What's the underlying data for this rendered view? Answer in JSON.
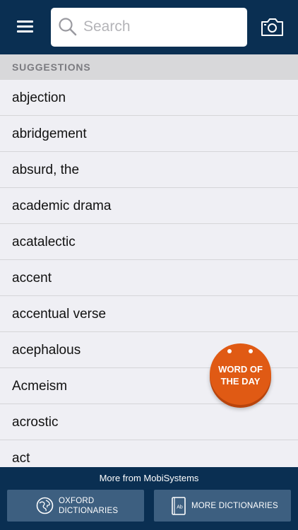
{
  "search": {
    "placeholder": "Search"
  },
  "section_header": "SUGGESTIONS",
  "suggestions": [
    "abjection",
    "abridgement",
    "absurd, the",
    "academic drama",
    "acatalectic",
    "accent",
    "accentual verse",
    "acephalous",
    "Acmeism",
    "acrostic",
    "act"
  ],
  "word_of_the_day": {
    "line1": "WORD OF",
    "line2": "THE DAY"
  },
  "footer": {
    "title": "More from MobiSystems",
    "oxford_line1": "OXFORD",
    "oxford_line2": "DICTIONARIES",
    "more_label": "MORE DICTIONARIES",
    "book_icon_text": "Ab"
  },
  "colors": {
    "header_bg": "#0a2f52",
    "accent_orange": "#e05a14",
    "button_bg": "#3d5f80"
  },
  "icons": [
    "hamburger-menu-icon",
    "search-icon",
    "camera-icon",
    "globe-icon",
    "book-icon"
  ]
}
